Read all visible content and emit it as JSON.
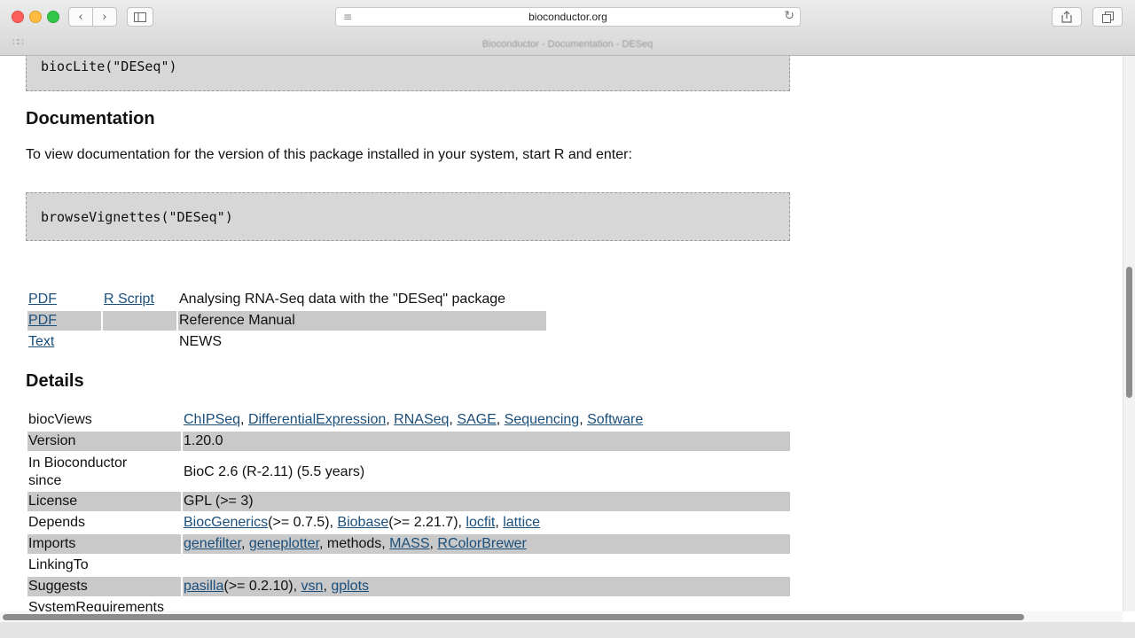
{
  "browser": {
    "url": "bioconductor.org",
    "tab_title": "Bioconductor - Documentation - DESeq"
  },
  "page": {
    "install_code": "biocLite(\"DESeq\")",
    "documentation_heading": "Documentation",
    "documentation_text": "To view documentation for the version of this package installed in your system, start R and enter:",
    "vignette_code": "browseVignettes(\"DESeq\")",
    "vignettes": [
      {
        "format": "PDF",
        "script": "R Script",
        "title": "Analysing RNA-Seq data with the \"DESeq\" package"
      },
      {
        "format": "PDF",
        "script": "",
        "title": "Reference Manual"
      },
      {
        "format": "Text",
        "script": "",
        "title": "NEWS"
      }
    ],
    "details_heading": "Details",
    "details": {
      "biocviews": {
        "key": "biocViews",
        "links": [
          "ChIPSeq",
          "DifferentialExpression",
          "RNASeq",
          "SAGE",
          "Sequencing",
          "Software"
        ]
      },
      "version": {
        "key": "Version",
        "value": "1.20.0"
      },
      "since": {
        "key_line1": "In Bioconductor",
        "key_line2": "since",
        "value": "BioC 2.6 (R-2.11) (5.5 years)"
      },
      "license": {
        "key": "License",
        "value": "GPL (>= 3)"
      },
      "depends": {
        "key": "Depends",
        "items": [
          {
            "name": "BiocGenerics",
            "suffix": "(>= 0.7.5), "
          },
          {
            "name": "Biobase",
            "suffix": "(>= 2.21.7), "
          },
          {
            "name": "locfit",
            "suffix": ", "
          },
          {
            "name": "lattice",
            "suffix": ""
          }
        ]
      },
      "imports": {
        "key": "Imports",
        "link1": "genefilter",
        "link2": "geneplotter",
        "plain": "methods",
        "link3": "MASS",
        "link4": "RColorBrewer"
      },
      "linkingto": {
        "key": "LinkingTo"
      },
      "suggests": {
        "key": "Suggests",
        "link1": "pasilla",
        "link1_suffix": "(>= 0.2.10), ",
        "link2": "vsn",
        "link3": "gplots"
      },
      "sysreq": {
        "key": "SystemRequirements"
      }
    }
  }
}
